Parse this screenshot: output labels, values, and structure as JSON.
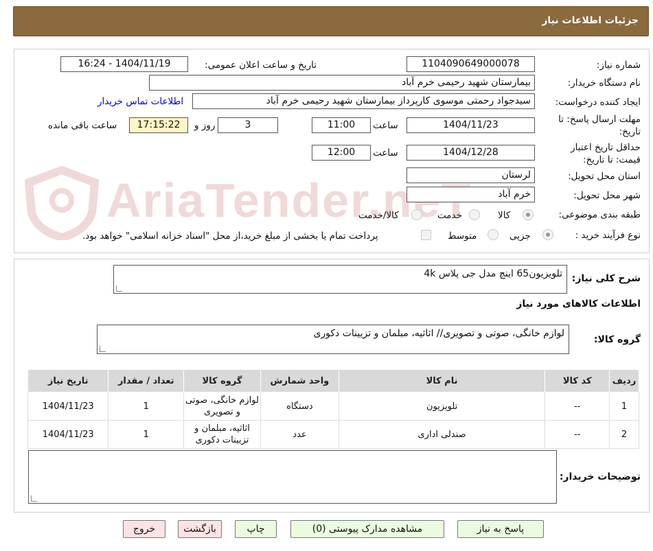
{
  "header": {
    "title": "جزئیات اطلاعات نیاز"
  },
  "watermark": {
    "text": "AriaTender.neT"
  },
  "fields": {
    "need_number_label": "شماره نیاز:",
    "need_number": "1104090649000078",
    "announce_label": "تاریخ و ساعت اعلان عمومی:",
    "announce_value": "1404/11/19 - 16:24",
    "buyer_org_label": "نام دستگاه خریدار:",
    "buyer_org": "بیمارستان شهید رحیمی خرم آباد",
    "creator_label": "ایجاد کننده درخواست:",
    "creator": "سیدجواد رحمتی موسوی کارپرداز بیمارستان شهید رحیمی خرم آباد",
    "contact_link": "اطلاعات تماس خریدار",
    "deadline_label_1": "مهلت ارسال پاسخ: تا",
    "deadline_label_2": "تاریخ:",
    "deadline_date": "1404/11/23",
    "time_label": "ساعت",
    "deadline_time": "11:00",
    "days_value": "3",
    "days_label": "روز و",
    "remaining_time": "17:15:22",
    "remaining_label": "ساعت باقی مانده",
    "validity_label_1": "حداقل تاریخ اعتبار",
    "validity_label_2": "قیمت: تا تاریخ:",
    "validity_date": "1404/12/28",
    "validity_time": "12:00",
    "province_label": "استان محل تحویل:",
    "province": "لرستان",
    "city_label": "شهر محل تحویل:",
    "city": "خرم آباد",
    "category_label": "طبقه بندی موضوعی:",
    "category_options": [
      "کالا",
      "خدمت",
      "کالا/خدمت"
    ],
    "process_label": "نوع فرآیند خرید :",
    "process_options": [
      "جزیی",
      "متوسط"
    ],
    "treasury_note": "پرداخت تمام یا بخشی از مبلغ خرید،از محل \"اسناد خزانه اسلامی\" خواهد بود."
  },
  "summary": {
    "label": "شرح کلی نیاز:",
    "value": "تلویزیون65 اینچ مدل جی پلاس 4k",
    "goods_info_title": "اطلاعات کالاهای مورد نیاز",
    "goods_group_label": "گروه کالا:",
    "goods_group": "لوازم خانگی، صوتی و تصویری// اثاثیه، مبلمان و تزیینات دکوری"
  },
  "table": {
    "headers": [
      "ردیف",
      "کد کالا",
      "نام کالا",
      "واحد شمارش",
      "گروه کالا",
      "تعداد / مقدار",
      "تاریخ نیاز"
    ],
    "rows": [
      [
        "1",
        "--",
        "تلویزیون",
        "دستگاه",
        "لوازم خانگی، صوتی و تصویری",
        "1",
        "1404/11/23"
      ],
      [
        "2",
        "--",
        "صندلی اداری",
        "عدد",
        "اثاثیه، مبلمان و تزیینات دکوری",
        "1",
        "1404/11/23"
      ]
    ]
  },
  "buyer_notes": {
    "label": "توضیحات خریدار:",
    "value": ""
  },
  "buttons": {
    "reply": "پاسخ به نیاز",
    "attachments": "مشاهده مدارک پیوستی (0)",
    "print": "چاپ",
    "back": "بازگشت",
    "exit": "خروج"
  }
}
